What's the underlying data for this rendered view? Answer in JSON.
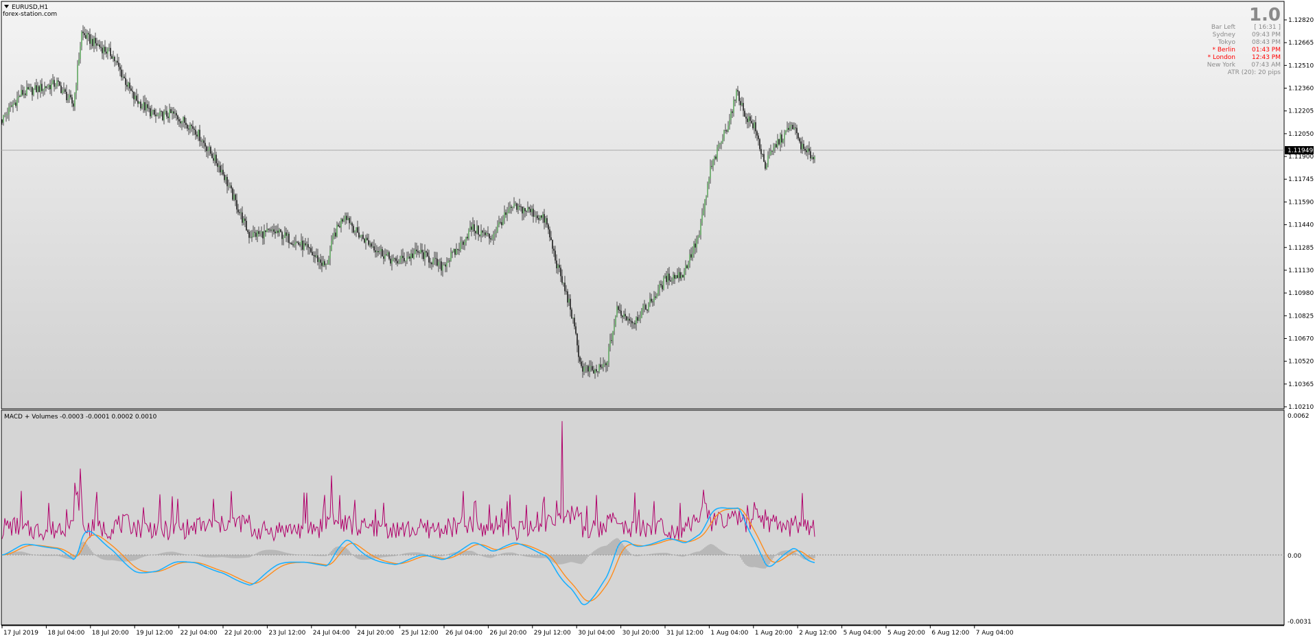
{
  "window": {
    "symbol_title": "EURUSD,H1",
    "subtitle": "forex-station.com"
  },
  "info_panel": {
    "big_value": "1.0",
    "rows": [
      {
        "label": "Bar Left",
        "value": "[ 16:31 ]",
        "highlight": false
      },
      {
        "label": "Sydney",
        "value": "09:43 PM",
        "highlight": false
      },
      {
        "label": "Tokyo",
        "value": "08:43 PM",
        "highlight": false
      },
      {
        "label": "* Berlin",
        "value": "01:43 PM",
        "highlight": true
      },
      {
        "label": "* London",
        "value": "12:43 PM",
        "highlight": true
      },
      {
        "label": "New York",
        "value": "07:43 AM",
        "highlight": false
      }
    ],
    "atr_text": "ATR (20): 20 pips",
    "highlight_color": "#ff0000"
  },
  "price_axis": {
    "ticks": [
      "1.12820",
      "1.12665",
      "1.12510",
      "1.12360",
      "1.12205",
      "1.12050",
      "1.11900",
      "1.11745",
      "1.11590",
      "1.11440",
      "1.11285",
      "1.11130",
      "1.10980",
      "1.10825",
      "1.10670",
      "1.10520",
      "1.10365",
      "1.10210"
    ],
    "current_price_label": "1.11949"
  },
  "indicator": {
    "title": "MACD + Volumes -0.0003 -0.0001 0.0002 0.0010",
    "axis_ticks": [
      "0.0062",
      "0.00",
      "-0.0031"
    ]
  },
  "time_axis": {
    "labels": [
      "17 Jul 2019",
      "18 Jul 04:00",
      "18 Jul 20:00",
      "19 Jul 12:00",
      "22 Jul 04:00",
      "22 Jul 20:00",
      "23 Jul 12:00",
      "24 Jul 04:00",
      "24 Jul 20:00",
      "25 Jul 12:00",
      "26 Jul 04:00",
      "26 Jul 20:00",
      "29 Jul 12:00",
      "30 Jul 04:00",
      "30 Jul 20:00",
      "31 Jul 12:00",
      "1 Aug 04:00",
      "1 Aug 20:00",
      "2 Aug 12:00",
      "5 Aug 04:00",
      "5 Aug 20:00",
      "6 Aug 12:00",
      "7 Aug 04:00"
    ]
  },
  "chart_data": {
    "type": "candlestick",
    "symbol": "EURUSD",
    "timeframe": "H1",
    "price_range": [
      1.1021,
      1.1289
    ],
    "current_price": 1.11949,
    "price_path_keypoints": [
      [
        0,
        1.122
      ],
      [
        14,
        1.1238
      ],
      [
        40,
        1.1245
      ],
      [
        52,
        1.123
      ],
      [
        58,
        1.128
      ],
      [
        64,
        1.1275
      ],
      [
        80,
        1.1265
      ],
      [
        96,
        1.1235
      ],
      [
        112,
        1.1222
      ],
      [
        124,
        1.1224
      ],
      [
        140,
        1.1214
      ],
      [
        160,
        1.1185
      ],
      [
        180,
        1.114
      ],
      [
        200,
        1.1142
      ],
      [
        220,
        1.1132
      ],
      [
        236,
        1.1118
      ],
      [
        242,
        1.114
      ],
      [
        250,
        1.1155
      ],
      [
        258,
        1.1142
      ],
      [
        268,
        1.1134
      ],
      [
        286,
        1.1121
      ],
      [
        304,
        1.1128
      ],
      [
        320,
        1.1118
      ],
      [
        332,
        1.113
      ],
      [
        342,
        1.1145
      ],
      [
        356,
        1.1138
      ],
      [
        364,
        1.115
      ],
      [
        372,
        1.1159
      ],
      [
        384,
        1.1157
      ],
      [
        396,
        1.115
      ],
      [
        404,
        1.112
      ],
      [
        414,
        1.109
      ],
      [
        422,
        1.1048
      ],
      [
        432,
        1.1045
      ],
      [
        440,
        1.105
      ],
      [
        448,
        1.1088
      ],
      [
        460,
        1.108
      ],
      [
        472,
        1.1093
      ],
      [
        484,
        1.111
      ],
      [
        496,
        1.1113
      ],
      [
        508,
        1.114
      ],
      [
        516,
        1.1185
      ],
      [
        528,
        1.1215
      ],
      [
        536,
        1.124
      ],
      [
        540,
        1.1225
      ],
      [
        548,
        1.1215
      ],
      [
        556,
        1.1188
      ],
      [
        564,
        1.1203
      ],
      [
        576,
        1.1216
      ],
      [
        584,
        1.1198
      ],
      [
        592,
        1.1194
      ]
    ],
    "indicator": {
      "name": "MACD + Volumes",
      "parameters": [
        -0.0003,
        -0.0001,
        0.0002,
        0.001
      ],
      "range": [
        -0.0031,
        0.0062
      ],
      "series": [
        {
          "name": "MACD",
          "color": "#1ab0ff"
        },
        {
          "name": "Signal",
          "color": "#ff8c1a"
        },
        {
          "name": "Volume",
          "color": "#b0006a"
        },
        {
          "name": "Histogram",
          "color": "#a0a0a0"
        }
      ]
    }
  },
  "colors": {
    "bull_candle": "#5fa65f",
    "bear_candle": "#1a1a1a",
    "wick": "#202020",
    "axis_text": "#000000",
    "macd_line": "#1ab0ff",
    "signal_line": "#ff8c1a",
    "volume_line": "#b0006a",
    "histogram": "#a0a0a0"
  }
}
